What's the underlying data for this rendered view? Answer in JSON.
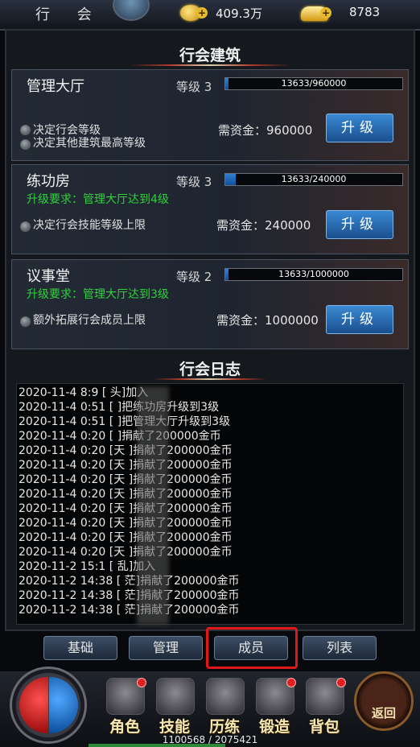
{
  "header": {
    "title": "行 会",
    "gold": "409.3万",
    "ingot": "8783",
    "plus": "+"
  },
  "buildings": {
    "section_title": "行会建筑",
    "items": [
      {
        "name": "管理大厅",
        "level": "等级 3",
        "progress": "13633/960000",
        "fraction": 0.0142,
        "requirement": "",
        "effects": [
          "决定行会等级",
          "决定其他建筑最高等级"
        ],
        "cost": "需资金：960000",
        "button": "升级"
      },
      {
        "name": "练功房",
        "level": "等级 3",
        "progress": "13633/240000",
        "fraction": 0.0568,
        "requirement": "升级要求：管理大厅达到4级",
        "effects": [
          "决定行会技能等级上限"
        ],
        "cost": "需资金：240000",
        "button": "升级"
      },
      {
        "name": "议事堂",
        "level": "等级 2",
        "progress": "13633/1000000",
        "fraction": 0.0136,
        "requirement": "升级要求：管理大厅达到3级",
        "effects": [
          "额外拓展行会成员上限"
        ],
        "cost": "需资金：1000000",
        "button": "升级"
      }
    ]
  },
  "log": {
    "section_title": "行会日志",
    "entries": [
      "2020-11-4 8:9    [      头]加入",
      "2020-11-4 0:51   [      ]把练功房升级到3级",
      "2020-11-4 0:51   [      ]把管理大厅升级到3级",
      "2020-11-4 0:20   [      ]捐献了200000金币",
      "2020-11-4 0:20   [天    ]捐献了200000金币",
      "2020-11-4 0:20   [天    ]捐献了200000金币",
      "2020-11-4 0:20   [天    ]捐献了200000金币",
      "2020-11-4 0:20   [天    ]捐献了200000金币",
      "2020-11-4 0:20   [天    ]捐献了200000金币",
      "2020-11-4 0:20   [天    ]捐献了200000金币",
      "2020-11-4 0:20   [天    ]捐献了200000金币",
      "2020-11-4 0:20   [天    ]捐献了200000金币",
      "2020-11-2 15:1   [    乱]加入",
      "2020-11-2 14:38  [    茫]捐献了200000金币",
      "2020-11-2 14:38  [    茫]捐献了200000金币",
      "2020-11-2 14:38  [    茫]捐献了200000金币"
    ]
  },
  "tabs": [
    "基础",
    "管理",
    "成员",
    "列表"
  ],
  "nav": {
    "items": [
      "角色",
      "技能",
      "历练",
      "锻造",
      "背包"
    ],
    "back": "返回",
    "exp": "1100568 / 2075421",
    "exp_fraction": 0.53
  }
}
